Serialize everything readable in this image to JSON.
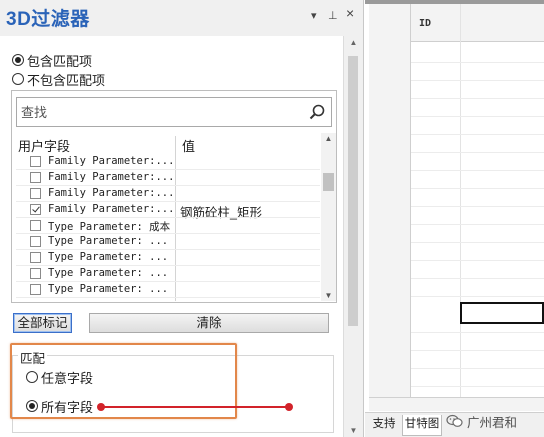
{
  "panel": {
    "title": "3D过滤器",
    "header_buttons": {
      "pin": "▾",
      "auto_hide": "⊥",
      "close": "×"
    }
  },
  "filter_mode": {
    "options": [
      {
        "label": "包含匹配项",
        "selected": true
      },
      {
        "label": "不包含匹配项",
        "selected": false
      }
    ]
  },
  "search": {
    "placeholder": "查找",
    "value": ""
  },
  "columns": {
    "field": "用户字段",
    "value": "值"
  },
  "rows": [
    {
      "name": "Family Parameter:...",
      "value": "",
      "checked": false
    },
    {
      "name": "Family Parameter:...",
      "value": "",
      "checked": false
    },
    {
      "name": "Family Parameter:...",
      "value": "",
      "checked": false
    },
    {
      "name": "Family Parameter:...",
      "value": "钢筋砼柱_矩形",
      "checked": true
    },
    {
      "name": "Type Parameter: 成本",
      "value": "",
      "checked": false
    },
    {
      "name": "Type Parameter: ...",
      "value": "",
      "checked": false
    },
    {
      "name": "Type Parameter: ...",
      "value": "",
      "checked": false
    },
    {
      "name": "Type Parameter: ...",
      "value": "",
      "checked": false
    },
    {
      "name": "Type Parameter: ...",
      "value": "",
      "checked": false
    }
  ],
  "buttons": {
    "mark_all": "全部标记",
    "clear": "清除"
  },
  "match": {
    "group_title": "匹配",
    "options": [
      {
        "label": "任意字段",
        "selected": false
      },
      {
        "label": "所有字段",
        "selected": true
      }
    ]
  },
  "grid": {
    "column_header": "ID"
  },
  "tabs": [
    {
      "label": "支持",
      "active": false
    },
    {
      "label": "甘特图",
      "active": true
    }
  ],
  "watermark": {
    "text": "广州君和"
  },
  "colors": {
    "title": "#2a63b8",
    "annotation_box": "#e2874a",
    "annotation_line": "#d2232a",
    "selected_button_border": "#3b6fc9"
  }
}
